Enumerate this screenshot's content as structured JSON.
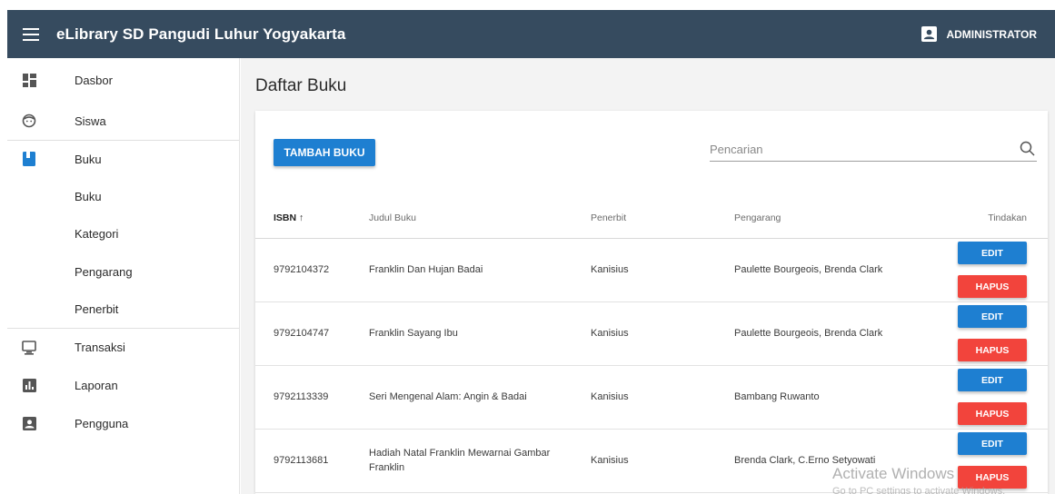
{
  "header": {
    "menu_icon": "menu-icon",
    "title": "eLibrary SD Pangudi Luhur Yogyakarta",
    "user_label": "ADMINISTRATOR",
    "user_icon": "account-box-icon",
    "color": "#364b5f"
  },
  "sidebar": {
    "items": [
      {
        "label": "Dasbor",
        "icon": "dashboard-icon"
      },
      {
        "label": "Siswa",
        "icon": "face-icon"
      },
      {
        "label": "Buku",
        "icon": "book-icon"
      },
      {
        "label": "Buku"
      },
      {
        "label": "Kategori"
      },
      {
        "label": "Pengarang"
      },
      {
        "label": "Penerbit"
      },
      {
        "label": "Transaksi",
        "icon": "computer-icon"
      },
      {
        "label": "Laporan",
        "icon": "chart-icon"
      },
      {
        "label": "Pengguna",
        "icon": "account-box-icon"
      }
    ]
  },
  "main": {
    "page_title": "Daftar Buku",
    "add_button": "TAMBAH BUKU",
    "search_placeholder": "Pencarian",
    "columns": {
      "isbn": "ISBN",
      "title": "Judul Buku",
      "publisher": "Penerbit",
      "author": "Pengarang",
      "actions": "Tindakan"
    },
    "rows": [
      {
        "isbn": "9792104372",
        "title": "Franklin Dan Hujan Badai",
        "publisher": "Kanisius",
        "author": "Paulette Bourgeois, Brenda Clark",
        "edit": "EDIT",
        "delete": "HAPUS"
      },
      {
        "isbn": "9792104747",
        "title": "Franklin Sayang Ibu",
        "publisher": "Kanisius",
        "author": "Paulette Bourgeois, Brenda Clark",
        "edit": "EDIT",
        "delete": "HAPUS"
      },
      {
        "isbn": "9792113339",
        "title": "Seri Mengenal Alam: Angin & Badai",
        "publisher": "Kanisius",
        "author": "Bambang Ruwanto",
        "edit": "EDIT",
        "delete": "HAPUS"
      },
      {
        "isbn": "9792113681",
        "title": "Hadiah Natal Franklin Mewarnai Gambar Franklin",
        "publisher": "Kanisius",
        "author": "Brenda Clark, C.Erno Setyowati",
        "edit": "EDIT",
        "delete": "HAPUS"
      }
    ],
    "colors": {
      "primary": "#1e7fd1",
      "danger": "#f2443c"
    }
  },
  "overlay": {
    "line1": "Activate Windows",
    "line2": "Go to PC settings to activate Windows."
  }
}
